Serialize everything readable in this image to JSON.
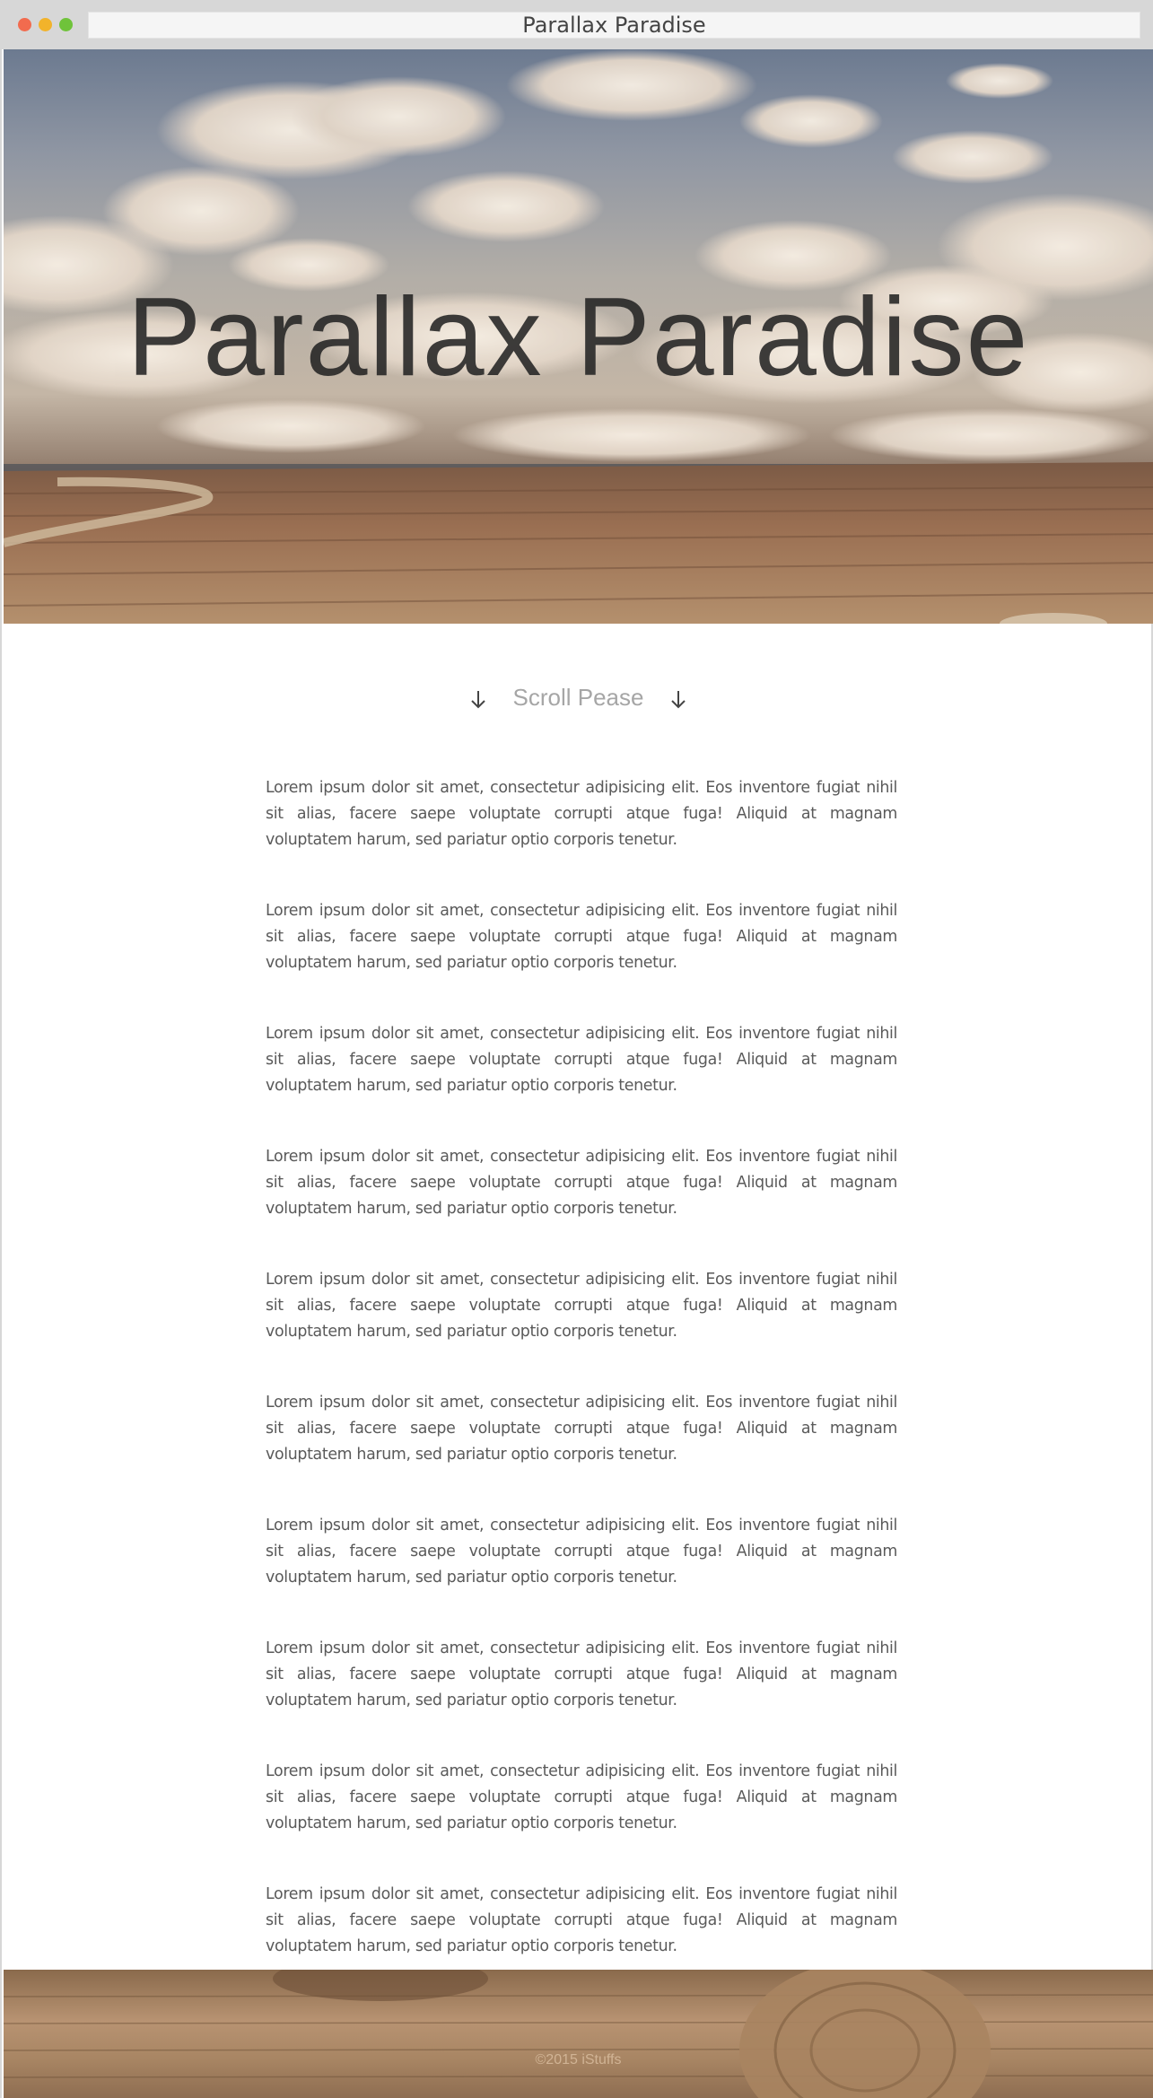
{
  "window": {
    "title": "Parallax Paradise"
  },
  "hero": {
    "title": "Parallax Paradise"
  },
  "scroll": {
    "label": "Scroll Pease"
  },
  "paragraphs": [
    "Lorem ipsum dolor sit amet, consectetur adipisicing elit. Eos inventore fugiat nihil sit alias, facere saepe voluptate corrupti atque fuga! Aliquid at magnam voluptatem harum, sed pariatur optio corporis tenetur.",
    "Lorem ipsum dolor sit amet, consectetur adipisicing elit. Eos inventore fugiat nihil sit alias, facere saepe voluptate corrupti atque fuga! Aliquid at magnam voluptatem harum, sed pariatur optio corporis tenetur.",
    "Lorem ipsum dolor sit amet, consectetur adipisicing elit. Eos inventore fugiat nihil sit alias, facere saepe voluptate corrupti atque fuga! Aliquid at magnam voluptatem harum, sed pariatur optio corporis tenetur.",
    "Lorem ipsum dolor sit amet, consectetur adipisicing elit. Eos inventore fugiat nihil sit alias, facere saepe voluptate corrupti atque fuga! Aliquid at magnam voluptatem harum, sed pariatur optio corporis tenetur.",
    "Lorem ipsum dolor sit amet, consectetur adipisicing elit. Eos inventore fugiat nihil sit alias, facere saepe voluptate corrupti atque fuga! Aliquid at magnam voluptatem harum, sed pariatur optio corporis tenetur.",
    "Lorem ipsum dolor sit amet, consectetur adipisicing elit. Eos inventore fugiat nihil sit alias, facere saepe voluptate corrupti atque fuga! Aliquid at magnam voluptatem harum, sed pariatur optio corporis tenetur.",
    "Lorem ipsum dolor sit amet, consectetur adipisicing elit. Eos inventore fugiat nihil sit alias, facere saepe voluptate corrupti atque fuga! Aliquid at magnam voluptatem harum, sed pariatur optio corporis tenetur.",
    "Lorem ipsum dolor sit amet, consectetur adipisicing elit. Eos inventore fugiat nihil sit alias, facere saepe voluptate corrupti atque fuga! Aliquid at magnam voluptatem harum, sed pariatur optio corporis tenetur.",
    "Lorem ipsum dolor sit amet, consectetur adipisicing elit. Eos inventore fugiat nihil sit alias, facere saepe voluptate corrupti atque fuga! Aliquid at magnam voluptatem harum, sed pariatur optio corporis tenetur.",
    "Lorem ipsum dolor sit amet, consectetur adipisicing elit. Eos inventore fugiat nihil sit alias, facere saepe voluptate corrupti atque fuga! Aliquid at magnam voluptatem harum, sed pariatur optio corporis tenetur."
  ],
  "footer": {
    "copyright": "©2015 iStuffs"
  },
  "colors": {
    "text": "#5a5a5a",
    "muted": "#a6a6a6",
    "chrome": "#d7d7d7"
  },
  "icons": {
    "scroll_left": "arrow-down-icon",
    "scroll_right": "arrow-down-icon"
  }
}
